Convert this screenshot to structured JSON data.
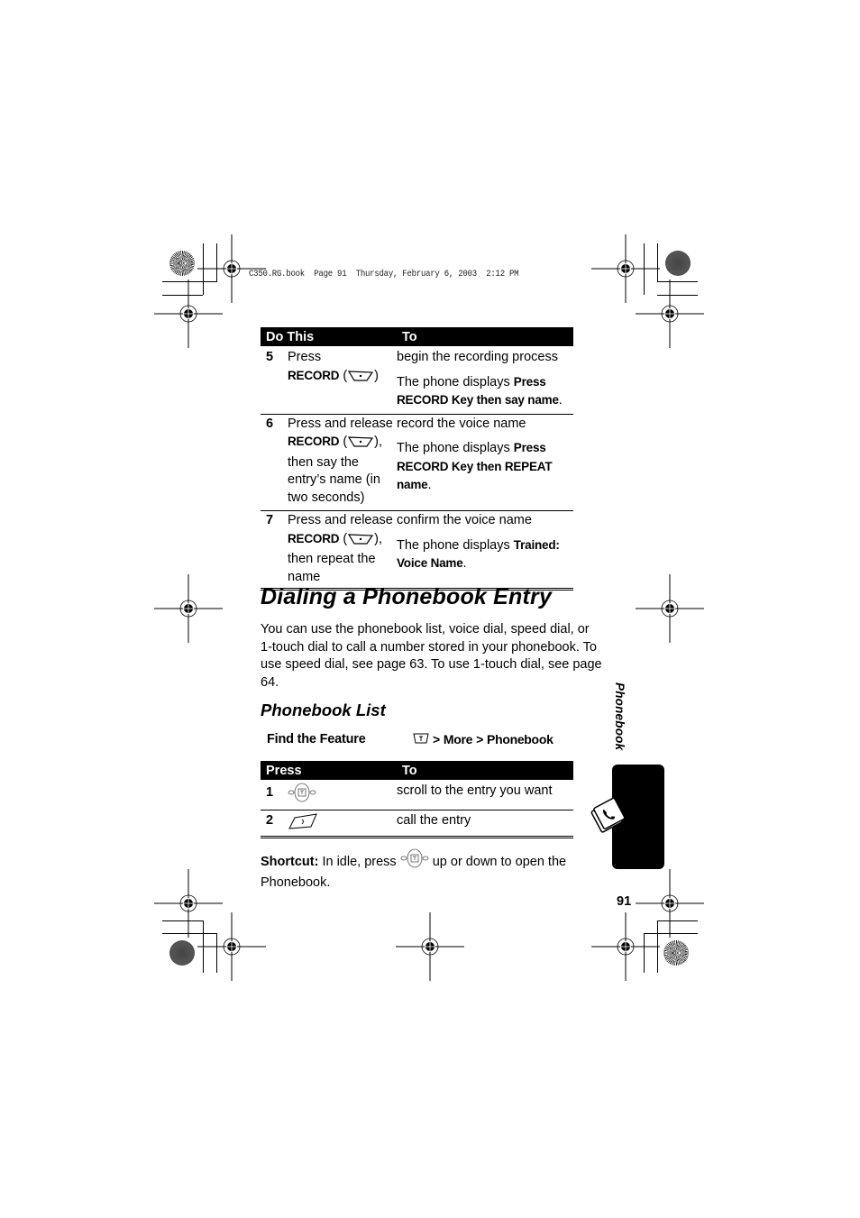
{
  "print_slug": "C350.RG.book  Page 91  Thursday, February 6, 2003  2:12 PM",
  "table1": {
    "headers": [
      "Do This",
      "To"
    ],
    "rows": [
      {
        "num": "5",
        "action_pre": "Press",
        "action_key": "RECORD",
        "action_post": "",
        "result": "begin the recording process",
        "display_pre": "The phone displays ",
        "display_msg": "Press RECORD Key then say name"
      },
      {
        "num": "6",
        "action_pre": "Press and release",
        "action_key": "RECORD",
        "action_post": ", then say the entry’s name (in two seconds)",
        "result": "record the voice name",
        "display_pre": "The phone displays ",
        "display_msg": "Press RECORD Key then REPEAT name"
      },
      {
        "num": "7",
        "action_pre": "Press and release",
        "action_key": "RECORD",
        "action_post": ", then repeat the name",
        "result": "confirm the voice name",
        "display_pre": "The phone displays ",
        "display_msg": "Trained: Voice Name"
      }
    ]
  },
  "section_title": "Dialing a Phonebook Entry",
  "intro": "You can use the phonebook list, voice dial, speed dial, or 1-touch dial to call a number stored in your phonebook. To use speed dial, see page 63. To use 1-touch dial, see page 64.",
  "subsection_title": "Phonebook List",
  "find_feature": {
    "label": "Find the Feature",
    "menu_icon": "menu-key-icon",
    "path": [
      "More",
      "Phonebook"
    ],
    "separator": ">"
  },
  "table2": {
    "headers": [
      "Press",
      "To"
    ],
    "rows": [
      {
        "num": "1",
        "icon": "navigation-key-icon",
        "result": "scroll to the entry you want"
      },
      {
        "num": "2",
        "icon": "send-key-icon",
        "result": "call the entry"
      }
    ]
  },
  "shortcut": {
    "label": "Shortcut:",
    "pre": " In idle, press ",
    "icon": "navigation-key-icon",
    "post": " up or down to open the Phonebook."
  },
  "side_tab": {
    "label": "Phonebook",
    "icon": "phonebook-icon"
  },
  "page_number": "91"
}
